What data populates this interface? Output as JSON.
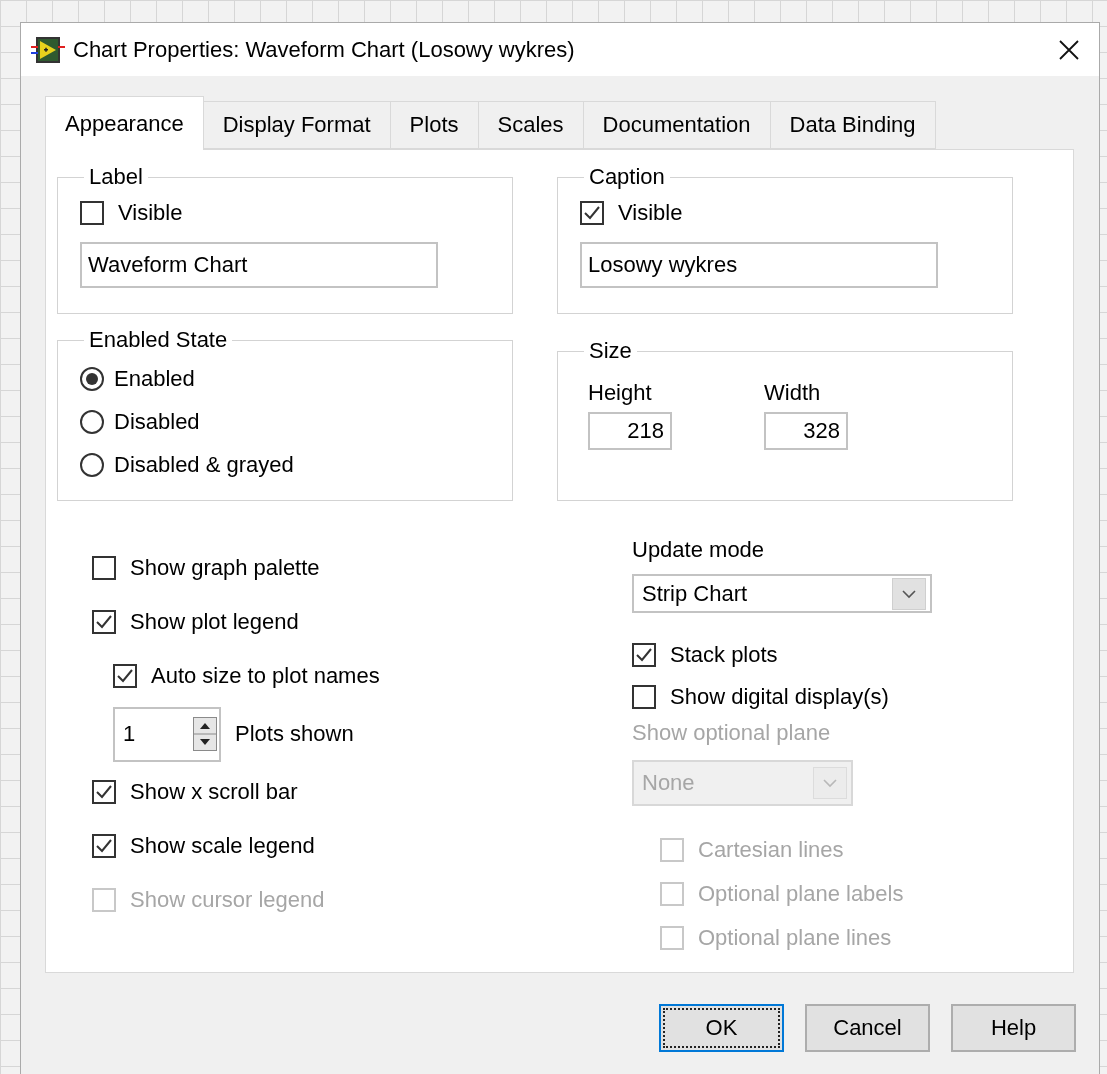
{
  "window": {
    "title": "Chart Properties: Waveform Chart (Losowy wykres)"
  },
  "tabs": [
    {
      "label": "Appearance",
      "selected": true
    },
    {
      "label": "Display Format",
      "selected": false
    },
    {
      "label": "Plots",
      "selected": false
    },
    {
      "label": "Scales",
      "selected": false
    },
    {
      "label": "Documentation",
      "selected": false
    },
    {
      "label": "Data Binding",
      "selected": false
    }
  ],
  "label_group": {
    "title": "Label",
    "visible": {
      "label": "Visible",
      "checked": false
    },
    "text": "Waveform Chart"
  },
  "caption_group": {
    "title": "Caption",
    "visible": {
      "label": "Visible",
      "checked": true
    },
    "text": "Losowy wykres"
  },
  "enabled_state": {
    "title": "Enabled State",
    "options": [
      {
        "label": "Enabled",
        "selected": true
      },
      {
        "label": "Disabled",
        "selected": false
      },
      {
        "label": "Disabled & grayed",
        "selected": false
      }
    ]
  },
  "size": {
    "title": "Size",
    "fields": [
      {
        "label": "Height",
        "value": "218"
      },
      {
        "label": "Width",
        "value": "328"
      }
    ]
  },
  "left_options": [
    {
      "kind": "checkbox",
      "label": "Show graph palette",
      "checked": false,
      "disabled": false
    },
    {
      "kind": "checkbox",
      "label": "Show plot legend",
      "checked": true,
      "disabled": false,
      "children": [
        {
          "kind": "checkbox",
          "label": "Auto size to plot names",
          "checked": true,
          "disabled": false
        },
        {
          "kind": "spinner",
          "value": "1",
          "caption": "Plots shown"
        }
      ]
    },
    {
      "kind": "checkbox",
      "label": "Show x scroll bar",
      "checked": true,
      "disabled": false
    },
    {
      "kind": "checkbox",
      "label": "Show scale legend",
      "checked": true,
      "disabled": false
    },
    {
      "kind": "checkbox",
      "label": "Show cursor legend",
      "checked": false,
      "disabled": true
    }
  ],
  "update_mode": {
    "label": "Update mode",
    "value": "Strip Chart"
  },
  "right_options": [
    {
      "kind": "checkbox",
      "label": "Stack plots",
      "checked": true,
      "disabled": false
    },
    {
      "kind": "checkbox",
      "label": "Show digital display(s)",
      "checked": false,
      "disabled": false
    }
  ],
  "optional_plane": {
    "label": "Show optional plane",
    "value": "None",
    "disabled": true,
    "options": [
      {
        "label": "Cartesian lines",
        "checked": false,
        "disabled": true
      },
      {
        "label": "Optional plane labels",
        "checked": false,
        "disabled": true
      },
      {
        "label": "Optional plane lines",
        "checked": false,
        "disabled": true
      }
    ]
  },
  "buttons": [
    {
      "label": "OK",
      "focused": true
    },
    {
      "label": "Cancel",
      "focused": false
    },
    {
      "label": "Help",
      "focused": false
    }
  ]
}
